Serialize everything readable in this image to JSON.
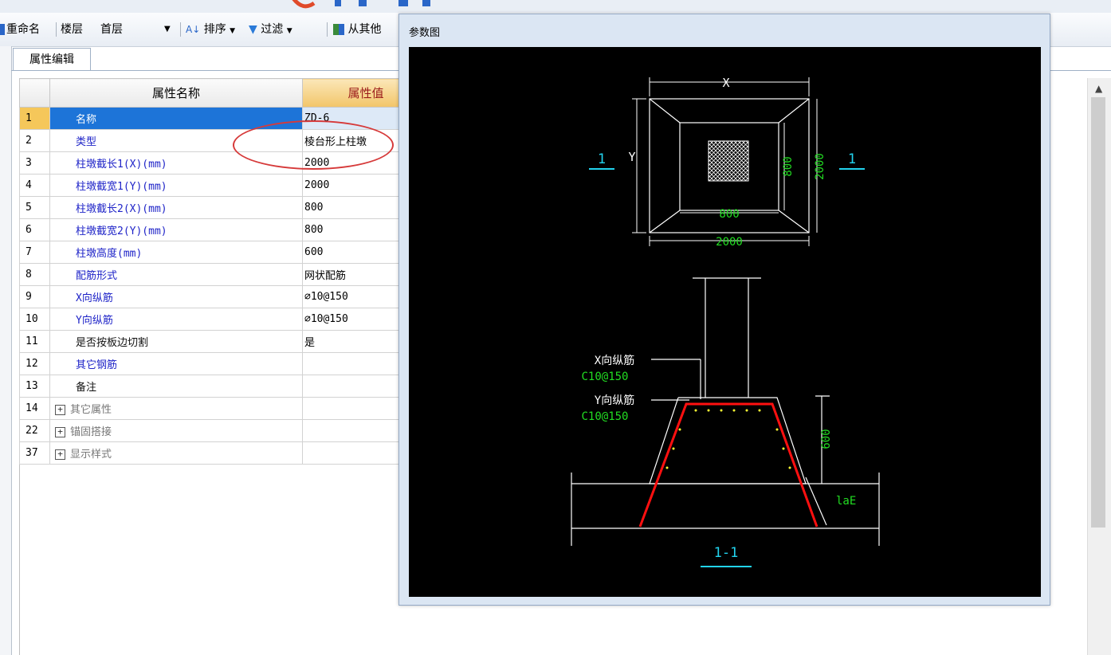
{
  "toolbar": {
    "rename_label": "重命名",
    "floor_label": "楼层",
    "floor_value": "首层",
    "sort_label": "排序",
    "filter_label": "过滤",
    "copy_label": "从其他"
  },
  "tab": {
    "label": "属性编辑"
  },
  "grid": {
    "header_name": "属性名称",
    "header_value": "属性值",
    "rows": [
      {
        "num": "1",
        "name": "名称",
        "value": "ZD-6"
      },
      {
        "num": "2",
        "name": "类型",
        "value": "棱台形上柱墩"
      },
      {
        "num": "3",
        "name": "柱墩截长1(X)(mm)",
        "value": "2000"
      },
      {
        "num": "4",
        "name": "柱墩截宽1(Y)(mm)",
        "value": "2000"
      },
      {
        "num": "5",
        "name": "柱墩截长2(X)(mm)",
        "value": "800"
      },
      {
        "num": "6",
        "name": "柱墩截宽2(Y)(mm)",
        "value": "800"
      },
      {
        "num": "7",
        "name": "柱墩高度(mm)",
        "value": "600"
      },
      {
        "num": "8",
        "name": "配筋形式",
        "value": "网状配筋"
      },
      {
        "num": "9",
        "name": "X向纵筋",
        "value": "⌀10@150"
      },
      {
        "num": "10",
        "name": "Y向纵筋",
        "value": "⌀10@150"
      },
      {
        "num": "11",
        "name": "是否按板边切割",
        "value": "是"
      },
      {
        "num": "12",
        "name": "其它钢筋",
        "value": ""
      },
      {
        "num": "13",
        "name": "备注",
        "value": ""
      },
      {
        "num": "14",
        "name": "其它属性",
        "value": ""
      },
      {
        "num": "22",
        "name": "锚固搭接",
        "value": ""
      },
      {
        "num": "37",
        "name": "显示样式",
        "value": ""
      }
    ]
  },
  "dialog": {
    "title": "参数图",
    "drawing": {
      "dim_x": "X",
      "dim_y": "Y",
      "dim_800_v": "800",
      "dim_2000_v": "2000",
      "dim_800_h": "800",
      "dim_2000_h": "2000",
      "section_mark_left": "1",
      "section_mark_right": "1",
      "label_x_bar": "X向纵筋",
      "label_x_spec": "C10@150",
      "label_y_bar": "Y向纵筋",
      "label_y_spec": "C10@150",
      "dim_600": "600",
      "label_lae": "laE",
      "section_title": "1-1"
    }
  },
  "colors": {
    "selected_row": "#1d74d8",
    "header_value_bg": "#f2c56a",
    "annotation_red": "#d63a3a",
    "drawing_bg": "#000000",
    "dim_green": "#22dd22",
    "mark_cyan": "#22d3ee",
    "rebar_red": "#ff1010",
    "rebar_dots": "#ffff33"
  }
}
